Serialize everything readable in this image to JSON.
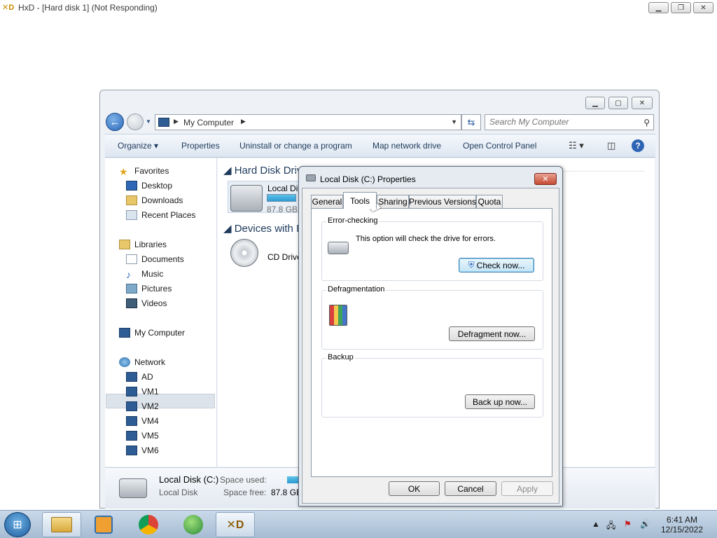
{
  "hxd": {
    "title": "HxD - [Hard disk 1] (Not Responding)",
    "icon": "hxd-app-icon"
  },
  "explorer": {
    "address": {
      "location": "My Computer"
    },
    "search": {
      "placeholder": "Search My Computer"
    },
    "toolbar": {
      "organize": "Organize",
      "properties": "Properties",
      "uninstall": "Uninstall or change a program",
      "map_drive": "Map network drive",
      "control_panel": "Open Control Panel"
    },
    "nav": {
      "favorites": "Favorites",
      "desktop": "Desktop",
      "downloads": "Downloads",
      "recent": "Recent Places",
      "libraries": "Libraries",
      "documents": "Documents",
      "music": "Music",
      "pictures": "Pictures",
      "videos": "Videos",
      "my_computer": "My Computer",
      "network": "Network",
      "hosts": [
        "AD",
        "VM1",
        "VM2",
        "VM4",
        "VM5",
        "VM6"
      ]
    },
    "content": {
      "hdd_group": "Hard Disk Driv",
      "hdd_name": "Local Dis",
      "hdd_free": "87.8 GB f",
      "hdd_used_fraction": 0.35,
      "removable_group": "Devices with R",
      "cd_name": "CD Drive"
    },
    "details": {
      "name": "Local Disk (C:)",
      "type": "Local Disk",
      "used_label": "Space used:",
      "free_label": "Space free:",
      "free_value": "87.8 GB"
    }
  },
  "dialog": {
    "title": "Local Disk (C:) Properties",
    "tabs": [
      "General",
      "Tools",
      "Sharing",
      "Previous Versions",
      "Quota"
    ],
    "active_tab": "Tools",
    "error_checking": {
      "legend": "Error-checking",
      "description": "This option will check the drive for errors.",
      "button": "Check now..."
    },
    "defrag": {
      "legend": "Defragmentation",
      "button": "Defragment now..."
    },
    "backup": {
      "legend": "Backup",
      "button": "Back up now..."
    },
    "buttons": {
      "ok": "OK",
      "cancel": "Cancel",
      "apply": "Apply"
    }
  },
  "taskbar": {
    "clock_time": "6:41 AM",
    "clock_date": "12/15/2022",
    "apps": [
      "windows-explorer-icon",
      "media-player-icon",
      "chrome-icon",
      "network-globe-icon",
      "hxd-app-icon"
    ]
  },
  "colors": {
    "accent": "#2b5ea3",
    "close_red": "#c44a33",
    "taskbar": "#b8cbe0"
  }
}
